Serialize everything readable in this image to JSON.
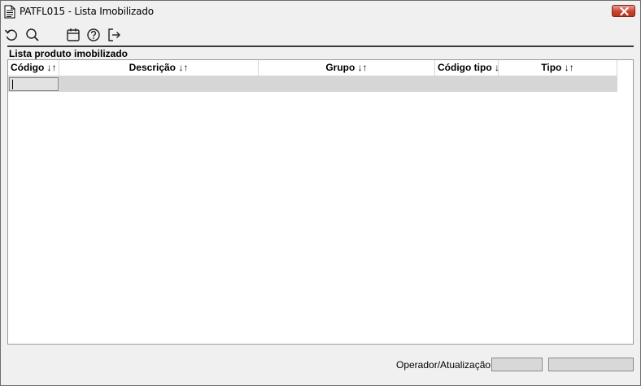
{
  "window": {
    "title": "PATFL015 - Lista Imobilizado"
  },
  "toolbar": {
    "icons": [
      "undo-icon",
      "search-icon",
      "calendar-icon",
      "help-icon",
      "exit-icon"
    ]
  },
  "section": {
    "title": "Lista produto imobilizado"
  },
  "grid": {
    "columns": [
      {
        "label": "Código ↓↑"
      },
      {
        "label": "Descrição ↓↑"
      },
      {
        "label": "Grupo ↓↑"
      },
      {
        "label": "Código tipo ↓↑"
      },
      {
        "label": "Tipo ↓↑"
      }
    ],
    "rows": [
      {
        "codigo": "",
        "descricao": "",
        "grupo": "",
        "codigo_tipo": "",
        "tipo": ""
      }
    ]
  },
  "status": {
    "label": "Operador/Atualização",
    "operator": "",
    "updated": ""
  },
  "colors": {
    "window_bg": "#f0f0f0",
    "close_button": "#c7432f",
    "selected_row": "#d6d6d6"
  }
}
